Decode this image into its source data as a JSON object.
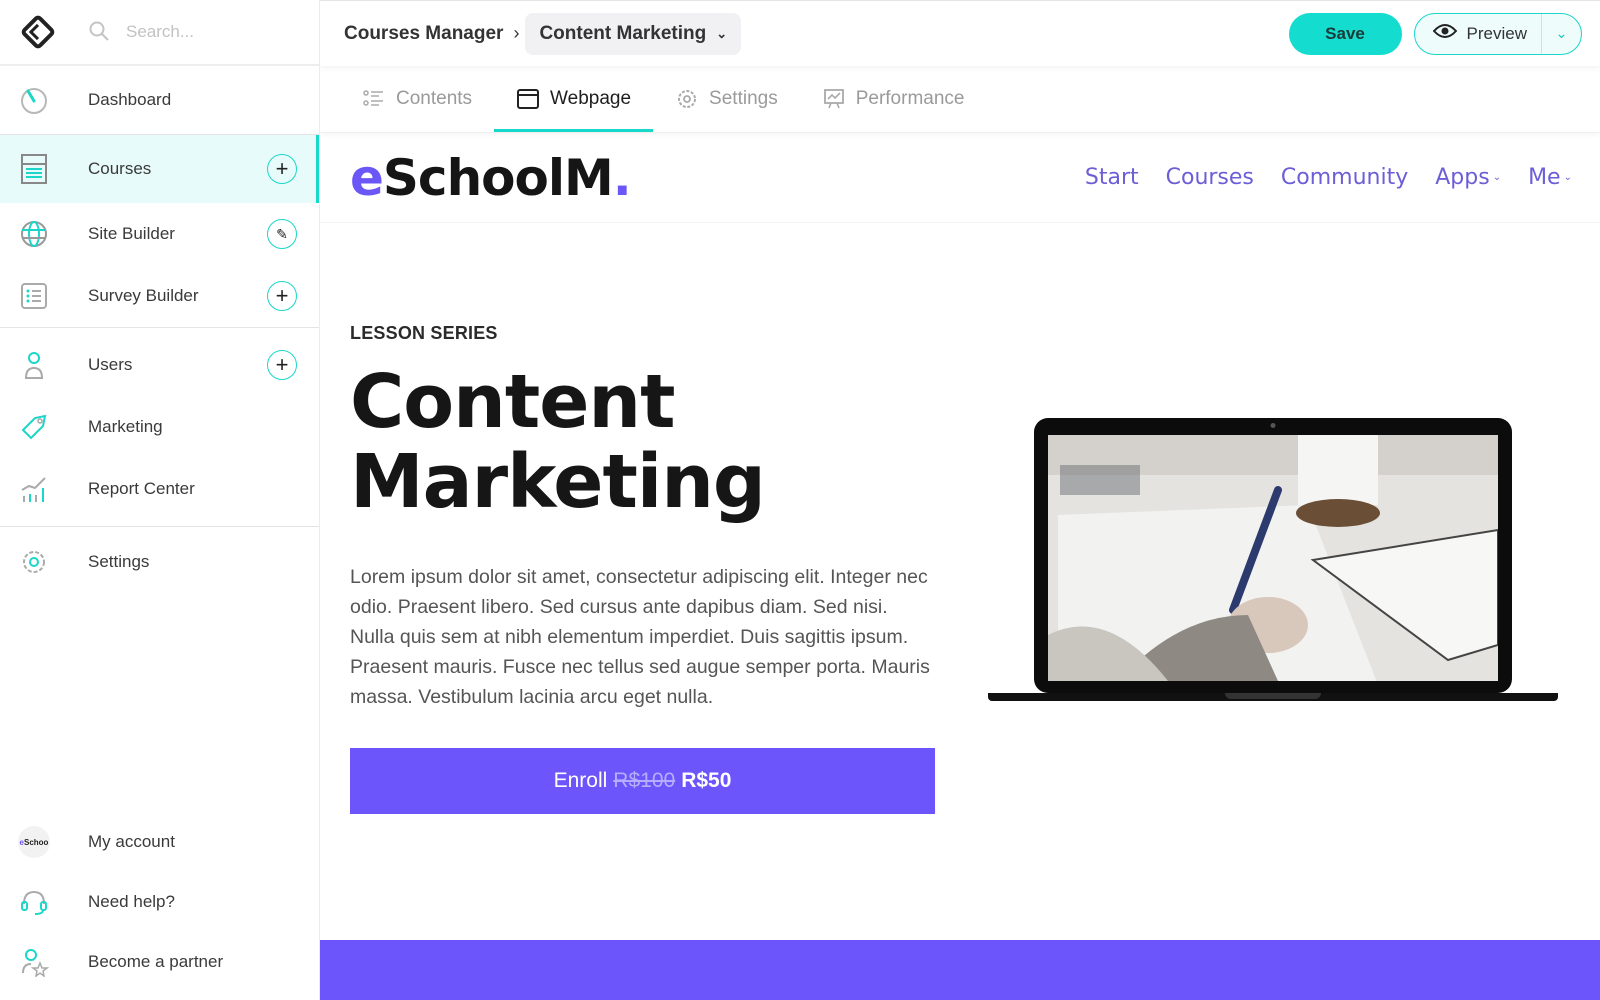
{
  "sidebar": {
    "search_placeholder": "Search...",
    "groups": [
      [
        {
          "label": "Dashboard",
          "icon": "dashboard-icon"
        }
      ],
      [
        {
          "label": "Courses",
          "icon": "courses-icon",
          "action": "add",
          "active": true
        },
        {
          "label": "Site Builder",
          "icon": "globe-icon",
          "action": "edit"
        },
        {
          "label": "Survey Builder",
          "icon": "survey-icon",
          "action": "add"
        }
      ],
      [
        {
          "label": "Users",
          "icon": "users-icon",
          "action": "add"
        },
        {
          "label": "Marketing",
          "icon": "tag-icon"
        },
        {
          "label": "Report Center",
          "icon": "report-icon"
        }
      ],
      [
        {
          "label": "Settings",
          "icon": "gear-icon"
        }
      ]
    ],
    "bottom": [
      {
        "label": "My account",
        "icon": "avatar",
        "avatar_text_e": "e",
        "avatar_text_rest": "Schoo"
      },
      {
        "label": "Need help?",
        "icon": "headset-icon"
      },
      {
        "label": "Become a partner",
        "icon": "partner-icon"
      }
    ]
  },
  "topbar": {
    "breadcrumb_root": "Courses Manager",
    "breadcrumb_sep": "›",
    "breadcrumb_current": "Content Marketing",
    "save_label": "Save",
    "preview_label": "Preview"
  },
  "tabs": [
    {
      "label": "Contents",
      "icon": "list-icon",
      "active": false
    },
    {
      "label": "Webpage",
      "icon": "window-icon",
      "active": true
    },
    {
      "label": "Settings",
      "icon": "gear-icon",
      "active": false
    },
    {
      "label": "Performance",
      "icon": "presentation-chart-icon",
      "active": false
    }
  ],
  "site": {
    "logo_e": "e",
    "logo_rest": "SchoolM",
    "logo_dot": ".",
    "nav": [
      {
        "label": "Start",
        "dropdown": false
      },
      {
        "label": "Courses",
        "dropdown": false
      },
      {
        "label": "Community",
        "dropdown": false
      },
      {
        "label": "Apps",
        "dropdown": true
      },
      {
        "label": "Me",
        "dropdown": true
      }
    ],
    "eyebrow": "LESSON SERIES",
    "title_line1": "Content",
    "title_line2": "Marketing",
    "description": "Lorem ipsum dolor sit amet, consectetur adipiscing elit. Integer nec odio. Praesent libero. Sed cursus ante dapibus diam. Sed nisi. Nulla quis sem at nibh elementum imperdiet. Duis sagittis ipsum. Praesent mauris. Fusce nec tellus sed augue semper porta. Mauris massa. Vestibulum lacinia arcu eget nulla.",
    "enroll_label": "Enroll",
    "old_price": "R$100",
    "new_price": "R$50"
  },
  "colors": {
    "accent_teal": "#16d9cc",
    "brand_purple": "#6b55fb"
  }
}
